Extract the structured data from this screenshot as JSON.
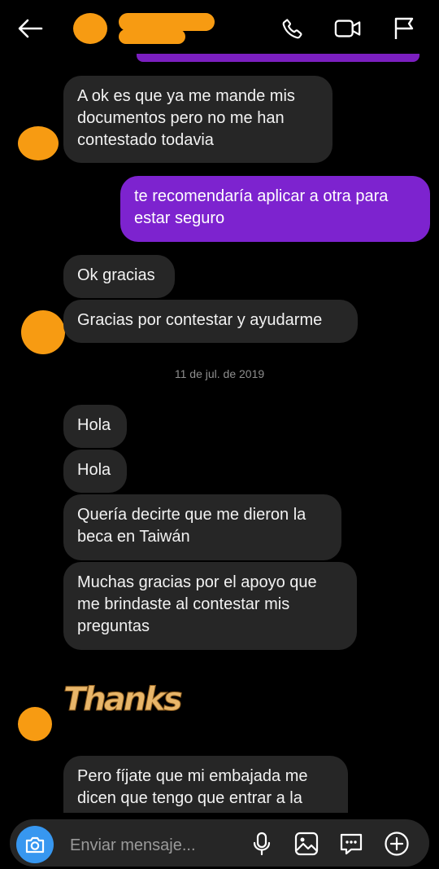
{
  "header": {
    "back_icon": "arrow-left-icon",
    "call_icon": "phone-icon",
    "video_icon": "video-camera-icon",
    "report_icon": "flag-icon",
    "accent": "#7d23cf",
    "redaction_color": "#f79b12"
  },
  "messages": [
    {
      "id": "m1",
      "direction": "incoming",
      "text": "A ok es que ya me mande mis\ndocumentos pero no me han\ncontestado todavia"
    },
    {
      "id": "m2",
      "direction": "outgoing",
      "text": "te recomendaría aplicar a otra para\nestar seguro"
    },
    {
      "id": "m3",
      "direction": "incoming",
      "text": "Ok gracias"
    },
    {
      "id": "m4",
      "direction": "incoming",
      "text": "Gracias por contestar y ayudarme"
    },
    {
      "id": "m5",
      "direction": "incoming",
      "text": "Hola"
    },
    {
      "id": "m6",
      "direction": "incoming",
      "text": "Hola"
    },
    {
      "id": "m7",
      "direction": "incoming",
      "text": "Quería decirte que me dieron la\nbeca en Taiwán"
    },
    {
      "id": "m8",
      "direction": "incoming",
      "text": "Muchas gracias por el apoyo que\nme brindaste al contestar mis\npreguntas"
    },
    {
      "id": "m9",
      "direction": "incoming",
      "text": "Pero fíjate que mi embajada me\ndicen que tengo que entrar a la"
    }
  ],
  "date_separator": "11 de jul. de 2019",
  "sticker": {
    "text": "Thanks"
  },
  "composer": {
    "placeholder": "Enviar mensaje...",
    "camera_icon": "camera-icon",
    "mic_icon": "microphone-icon",
    "gallery_icon": "image-icon",
    "sticker_icon": "chat-sticker-icon",
    "more_icon": "plus-circle-icon",
    "camera_color": "#3797f0"
  }
}
